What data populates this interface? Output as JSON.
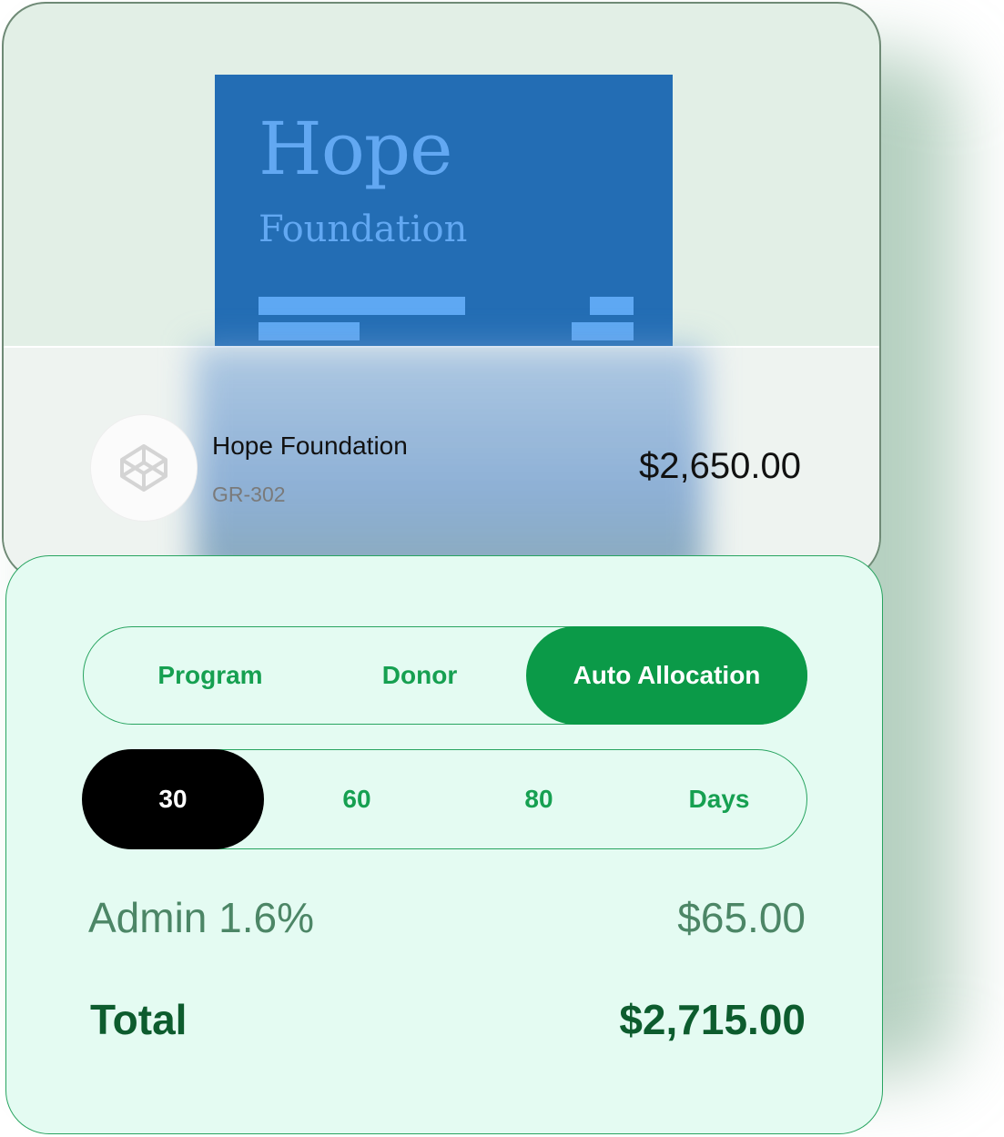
{
  "document": {
    "title": "Hope",
    "subtitle": "Foundation"
  },
  "payee": {
    "name": "Hope Foundation",
    "id": "GR-302",
    "amount": "$2,650.00"
  },
  "allocation_tabs": [
    {
      "label": "Program",
      "active": false
    },
    {
      "label": "Donor",
      "active": false
    },
    {
      "label": "Auto Allocation",
      "active": true
    }
  ],
  "terms": [
    {
      "label": "30",
      "active": true
    },
    {
      "label": "60",
      "active": false
    },
    {
      "label": "80",
      "active": false
    },
    {
      "label": "Days",
      "active": false
    }
  ],
  "fees": {
    "admin_label": "Admin 1.6%",
    "admin_value": "$65.00",
    "total_label": "Total",
    "total_value": "$2,715.00"
  },
  "colors": {
    "accent_green": "#0b9a48",
    "doc_blue": "#236db4",
    "total_green": "#0d5c2e"
  },
  "icons": {
    "avatar": "codepen-cube-icon"
  }
}
